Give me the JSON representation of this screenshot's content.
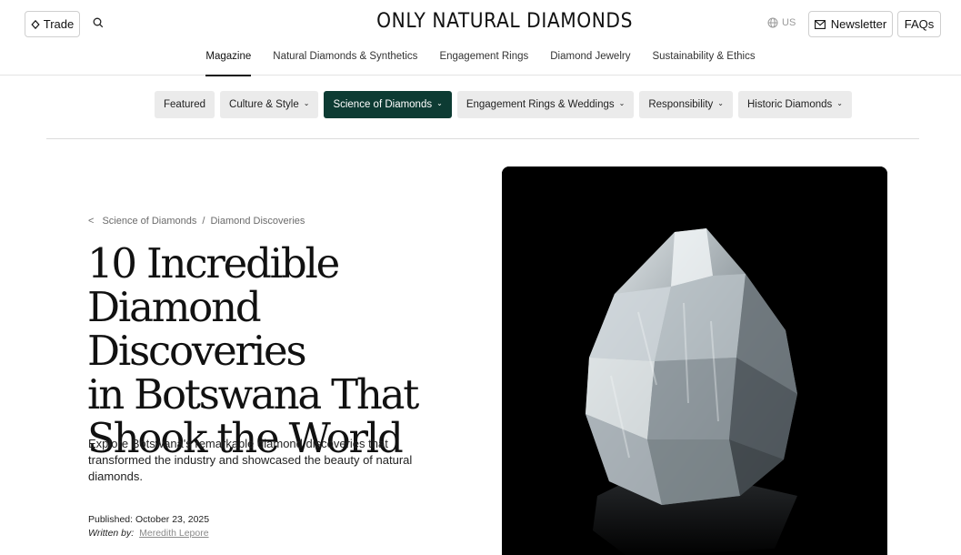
{
  "header": {
    "trade_label": "Trade",
    "logo_text": "ONLY NATURAL DIAMONDS",
    "region_label": "US",
    "newsletter_label": "Newsletter",
    "faq_label": "FAQs"
  },
  "main_nav": {
    "items": [
      {
        "label": "Magazine",
        "active": true
      },
      {
        "label": "Natural Diamonds & Synthetics"
      },
      {
        "label": "Engagement Rings"
      },
      {
        "label": "Diamond Jewelry"
      },
      {
        "label": "Sustainability & Ethics"
      }
    ]
  },
  "categories": {
    "items": [
      {
        "label": "Featured"
      },
      {
        "label": "Culture & Style",
        "dropdown": true
      },
      {
        "label": "Science of Diamonds",
        "dropdown": true,
        "active": true
      },
      {
        "label": "Engagement Rings & Weddings",
        "dropdown": true
      },
      {
        "label": "Responsibility",
        "dropdown": true
      },
      {
        "label": "Historic Diamonds",
        "dropdown": true
      }
    ]
  },
  "article": {
    "breadcrumb_back": "<",
    "breadcrumb_parent": "Science of Diamonds",
    "breadcrumb_sep": "/",
    "breadcrumb_current": "Diamond Discoveries",
    "title_lines": [
      "10 Incredible",
      "Diamond Discoveries",
      "in Botswana That",
      "Shook the World"
    ],
    "subtitle": "Explore Botswana's remarkable diamond discoveries that transformed the industry and showcased the beauty of natural diamonds.",
    "published": "Published: October 23, 2025",
    "written_by_label": "Written by:",
    "author": "Meredith Lepore"
  },
  "colors": {
    "accent_active_chip": "#0d3b33",
    "chip_bg": "#ebebeb",
    "hero_bg": "#000000"
  },
  "icons": {
    "trade": "diamond-outline-icon",
    "search": "search-icon",
    "region": "globe-icon",
    "newsletter": "envelope-icon",
    "dropdown": "chevron-down-icon",
    "back": "chevron-left-icon"
  }
}
